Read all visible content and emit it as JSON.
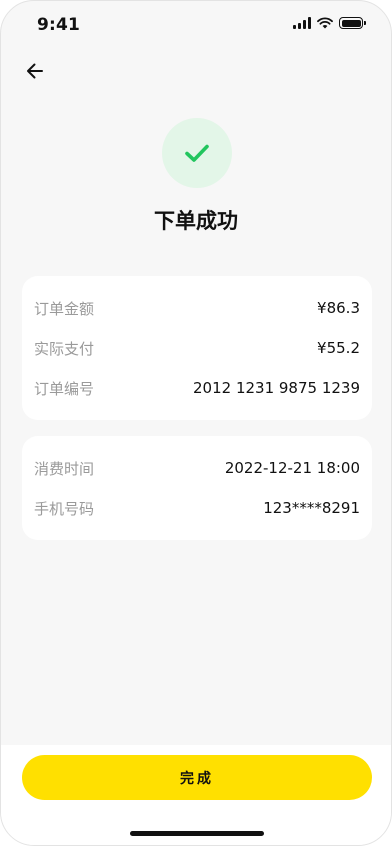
{
  "status_bar": {
    "time": "9:41",
    "icons": [
      "signal-icon",
      "wifi-icon",
      "battery-icon"
    ]
  },
  "header": {
    "back_icon": "arrow-left-icon"
  },
  "result": {
    "icon": "check-icon",
    "icon_color": "#22c55e",
    "icon_bg": "#e3f6e8",
    "title": "下单成功"
  },
  "order_info": {
    "rows": [
      {
        "label": "订单金额",
        "value": "¥86.3"
      },
      {
        "label": "实际支付",
        "value": "¥55.2"
      },
      {
        "label": "订单编号",
        "value": "2012 1231 9875 1239"
      }
    ]
  },
  "consume_info": {
    "rows": [
      {
        "label": "消费时间",
        "value": "2022-12-21 18:00"
      },
      {
        "label": "手机号码",
        "value": "123****8291"
      }
    ]
  },
  "footer": {
    "done_label": "完成",
    "button_color": "#ffe000"
  }
}
